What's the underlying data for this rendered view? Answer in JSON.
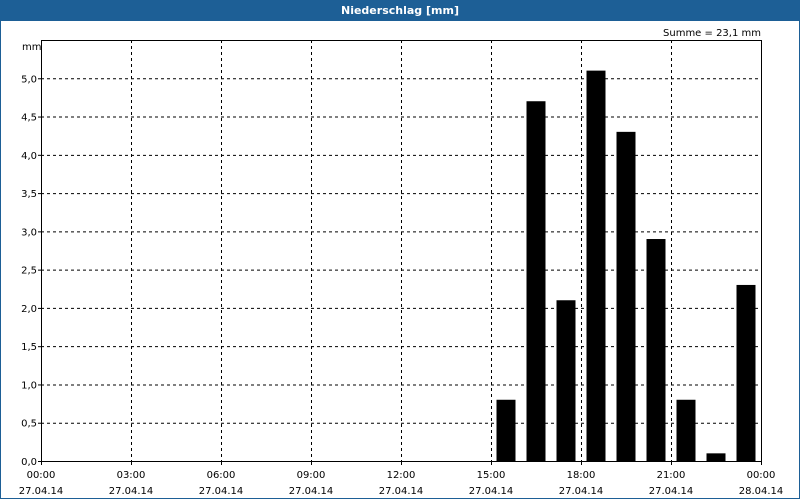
{
  "window": {
    "title": "Niederschlag [mm]"
  },
  "chart_data": {
    "type": "bar",
    "title": "Niederschlag [mm]",
    "ylabel": "mm",
    "summary": "Summe = 23,1 mm",
    "ylim": [
      0,
      5.5
    ],
    "y_ticks": [
      "0,0",
      "0,5",
      "1,0",
      "1,5",
      "2,0",
      "2,5",
      "3,0",
      "3,5",
      "4,0",
      "4,5",
      "5,0"
    ],
    "y_tick_values": [
      0,
      0.5,
      1.0,
      1.5,
      2.0,
      2.5,
      3.0,
      3.5,
      4.0,
      4.5,
      5.0
    ],
    "x_ticks": [
      {
        "time": "00:00",
        "date": "27.04.14",
        "hour": 0
      },
      {
        "time": "03:00",
        "date": "27.04.14",
        "hour": 3
      },
      {
        "time": "06:00",
        "date": "27.04.14",
        "hour": 6
      },
      {
        "time": "09:00",
        "date": "27.04.14",
        "hour": 9
      },
      {
        "time": "12:00",
        "date": "27.04.14",
        "hour": 12
      },
      {
        "time": "15:00",
        "date": "27.04.14",
        "hour": 15
      },
      {
        "time": "18:00",
        "date": "27.04.14",
        "hour": 18
      },
      {
        "time": "21:00",
        "date": "27.04.14",
        "hour": 21
      },
      {
        "time": "00:00",
        "date": "28.04.14",
        "hour": 24
      }
    ],
    "grid": true,
    "bar_color": "#000000",
    "bars": [
      {
        "hour": 15.5,
        "value": 0.8
      },
      {
        "hour": 16.5,
        "value": 4.7
      },
      {
        "hour": 17.5,
        "value": 2.1
      },
      {
        "hour": 18.5,
        "value": 5.1
      },
      {
        "hour": 19.5,
        "value": 4.3
      },
      {
        "hour": 20.5,
        "value": 2.9
      },
      {
        "hour": 21.5,
        "value": 0.8
      },
      {
        "hour": 22.5,
        "value": 0.1
      },
      {
        "hour": 23.5,
        "value": 2.3
      }
    ]
  }
}
